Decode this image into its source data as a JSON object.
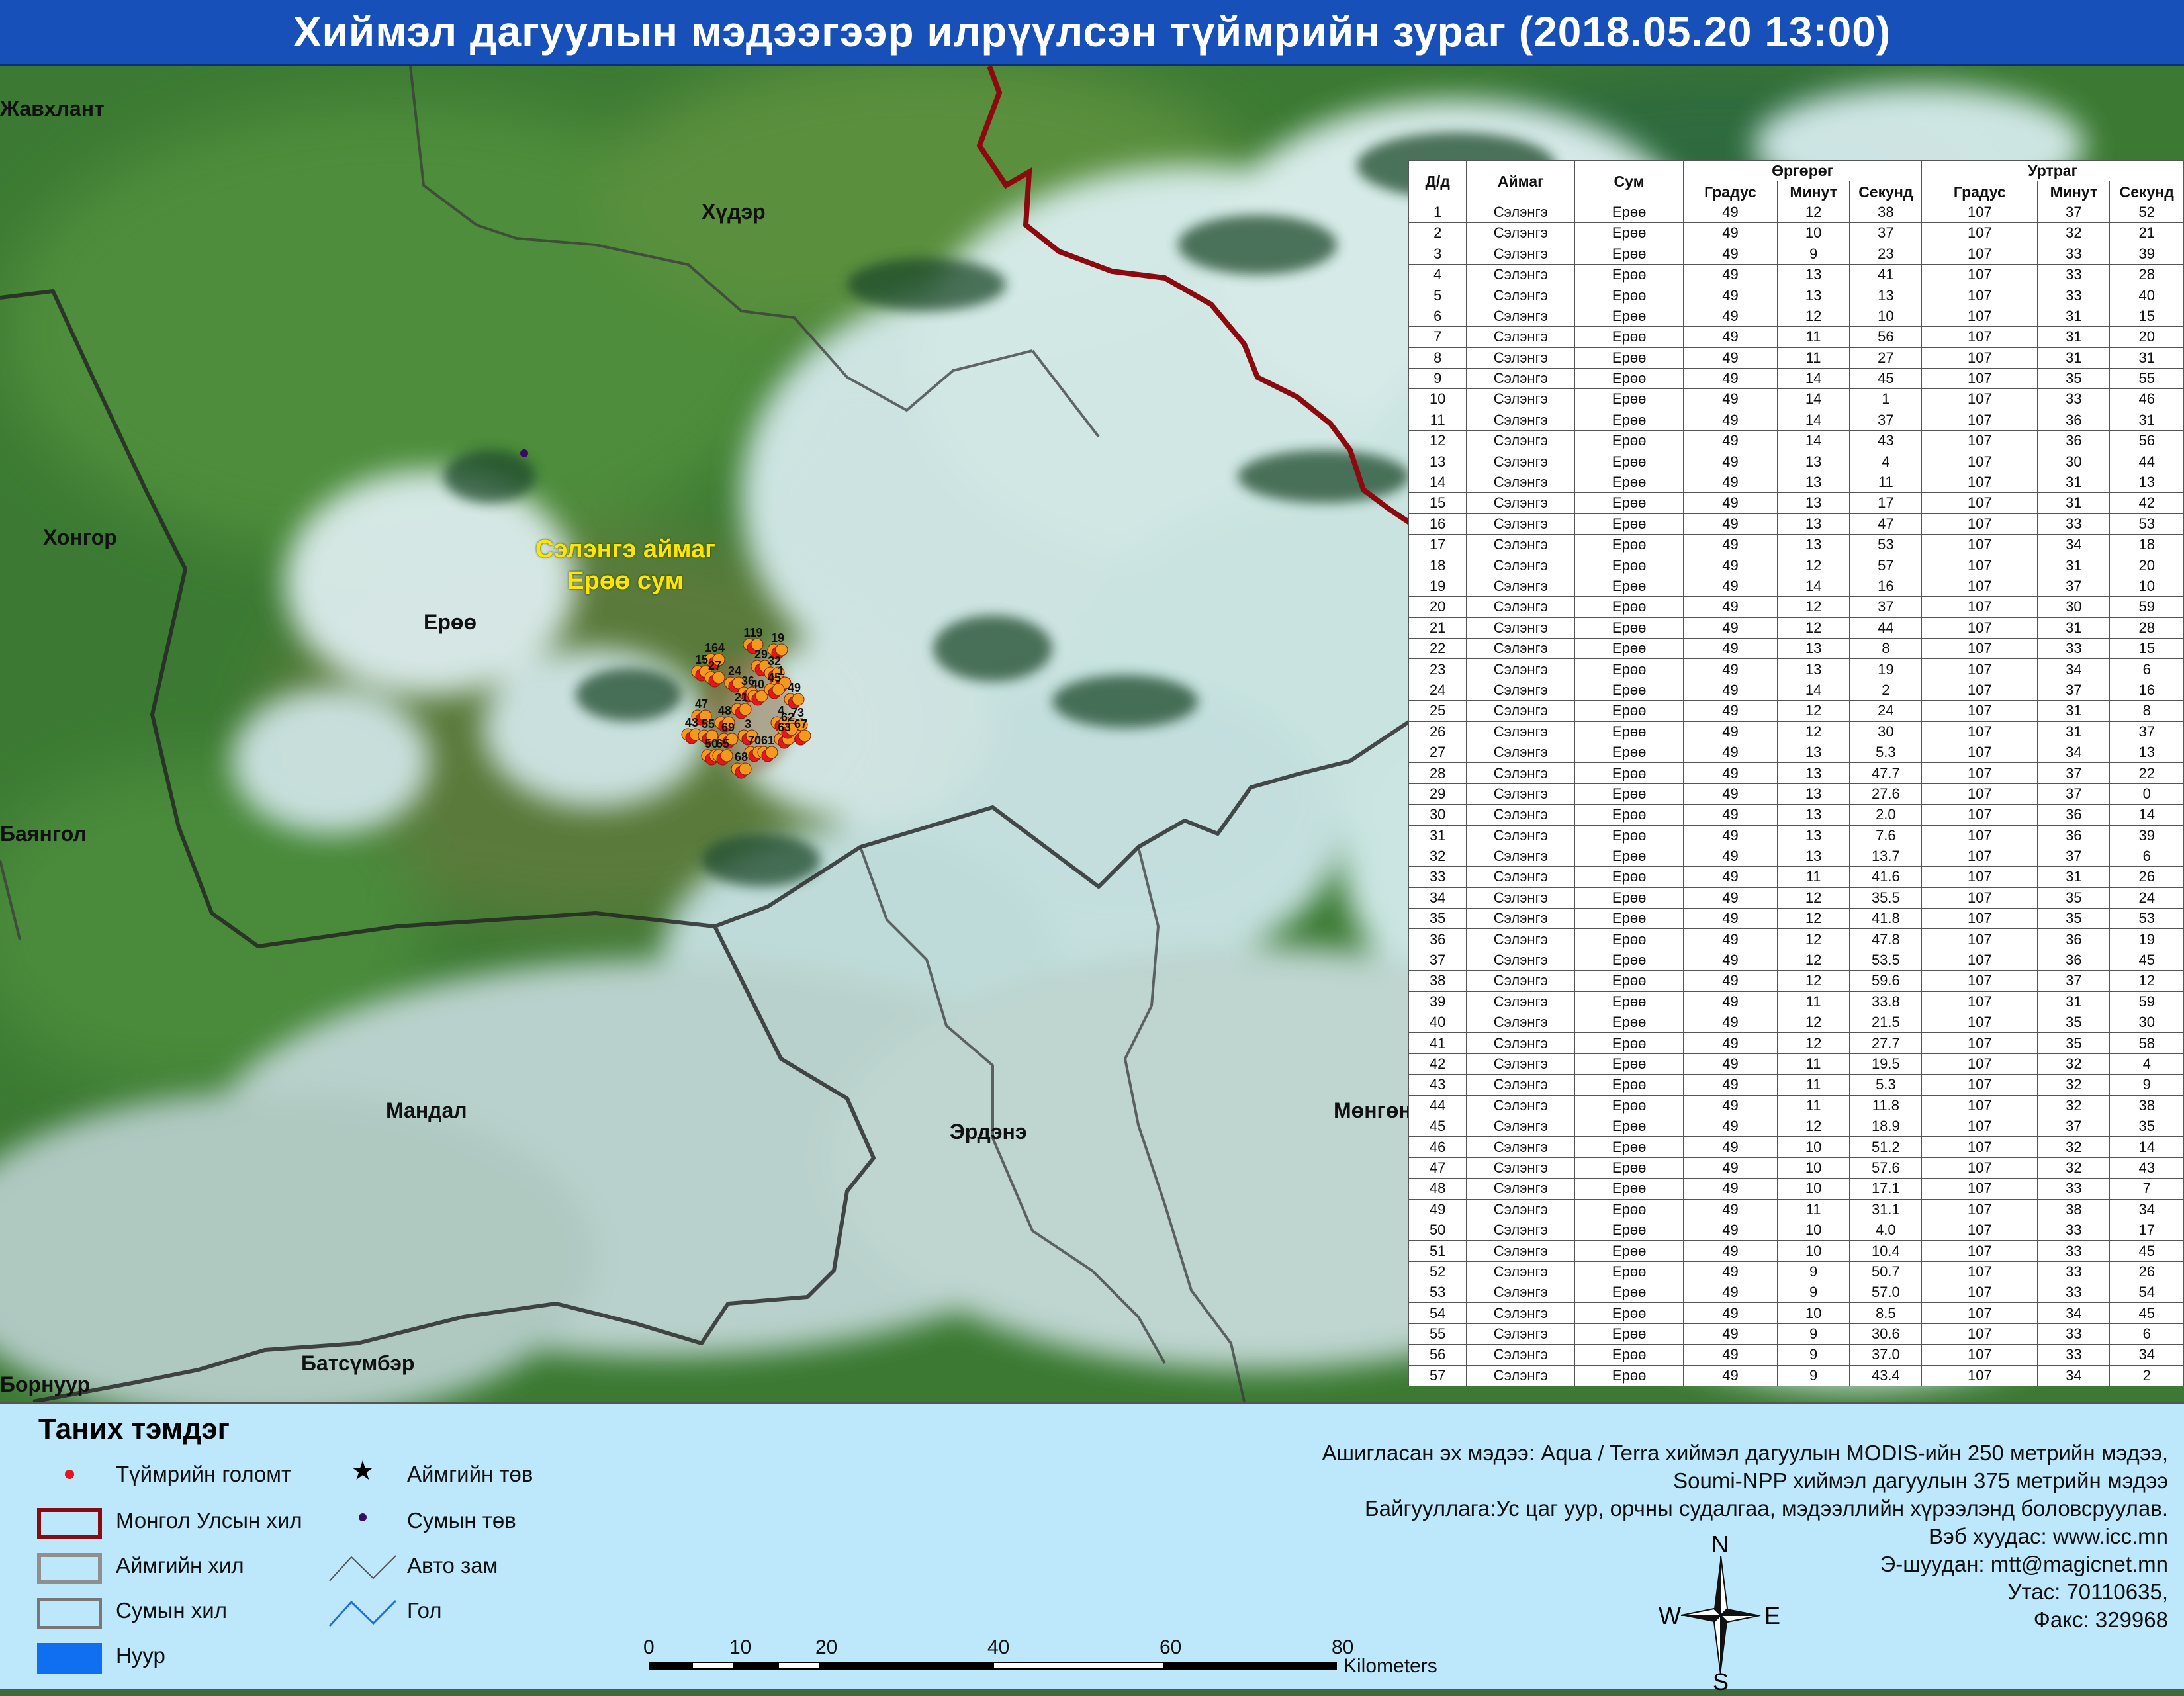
{
  "title": "Хиймэл дагуулын мэдээгээр илрүүлсэн түймрийн зураг  (2018.05.20 13:00)",
  "map": {
    "places": [
      {
        "id": "javkhlant",
        "name": "Жавхлант"
      },
      {
        "id": "khuder",
        "name": "Хүдэр"
      },
      {
        "id": "khongor",
        "name": "Хонгор"
      },
      {
        "id": "yeroo",
        "name": "Ерөө"
      },
      {
        "id": "bayangol",
        "name": "Баянгол"
      },
      {
        "id": "mandal",
        "name": "Мандал"
      },
      {
        "id": "erdene",
        "name": "Эрдэнэ"
      },
      {
        "id": "mungunmorit",
        "name": "Мөнгөн"
      },
      {
        "id": "batsumber",
        "name": "Батсүмбэр"
      },
      {
        "id": "bornuur",
        "name": "Борнуур"
      }
    ],
    "aimag_label_line1": "Сэлэнгэ аймаг",
    "aimag_label_line2": "Ерөө сум",
    "fire_numbers": [
      "119",
      "19",
      "164",
      "29",
      "32",
      "15",
      "27",
      "24",
      "1",
      "36",
      "40",
      "45",
      "49",
      "48",
      "43",
      "55",
      "69",
      "3",
      "4",
      "73",
      "67",
      "50",
      "65",
      "70",
      "61",
      "68",
      "63",
      "62",
      "47",
      "21"
    ]
  },
  "table": {
    "headers": {
      "no": "Д/д",
      "aimag": "Аймаг",
      "sum": "Сум",
      "lat": "Өргөрөг",
      "lon": "Уртраг",
      "deg": "Градус",
      "min": "Минут",
      "sec": "Секунд"
    },
    "rows": [
      [
        "1",
        "Сэлэнгэ",
        "Ерөө",
        "49",
        "12",
        "38",
        "107",
        "37",
        "52"
      ],
      [
        "2",
        "Сэлэнгэ",
        "Ерөө",
        "49",
        "10",
        "37",
        "107",
        "32",
        "21"
      ],
      [
        "3",
        "Сэлэнгэ",
        "Ерөө",
        "49",
        "9",
        "23",
        "107",
        "33",
        "39"
      ],
      [
        "4",
        "Сэлэнгэ",
        "Ерөө",
        "49",
        "13",
        "41",
        "107",
        "33",
        "28"
      ],
      [
        "5",
        "Сэлэнгэ",
        "Ерөө",
        "49",
        "13",
        "13",
        "107",
        "33",
        "40"
      ],
      [
        "6",
        "Сэлэнгэ",
        "Ерөө",
        "49",
        "12",
        "10",
        "107",
        "31",
        "15"
      ],
      [
        "7",
        "Сэлэнгэ",
        "Ерөө",
        "49",
        "11",
        "56",
        "107",
        "31",
        "20"
      ],
      [
        "8",
        "Сэлэнгэ",
        "Ерөө",
        "49",
        "11",
        "27",
        "107",
        "31",
        "31"
      ],
      [
        "9",
        "Сэлэнгэ",
        "Ерөө",
        "49",
        "14",
        "45",
        "107",
        "35",
        "55"
      ],
      [
        "10",
        "Сэлэнгэ",
        "Ерөө",
        "49",
        "14",
        "1",
        "107",
        "33",
        "46"
      ],
      [
        "11",
        "Сэлэнгэ",
        "Ерөө",
        "49",
        "14",
        "37",
        "107",
        "36",
        "31"
      ],
      [
        "12",
        "Сэлэнгэ",
        "Ерөө",
        "49",
        "14",
        "43",
        "107",
        "36",
        "56"
      ],
      [
        "13",
        "Сэлэнгэ",
        "Ерөө",
        "49",
        "13",
        "4",
        "107",
        "30",
        "44"
      ],
      [
        "14",
        "Сэлэнгэ",
        "Ерөө",
        "49",
        "13",
        "11",
        "107",
        "31",
        "13"
      ],
      [
        "15",
        "Сэлэнгэ",
        "Ерөө",
        "49",
        "13",
        "17",
        "107",
        "31",
        "42"
      ],
      [
        "16",
        "Сэлэнгэ",
        "Ерөө",
        "49",
        "13",
        "47",
        "107",
        "33",
        "53"
      ],
      [
        "17",
        "Сэлэнгэ",
        "Ерөө",
        "49",
        "13",
        "53",
        "107",
        "34",
        "18"
      ],
      [
        "18",
        "Сэлэнгэ",
        "Ерөө",
        "49",
        "12",
        "57",
        "107",
        "31",
        "20"
      ],
      [
        "19",
        "Сэлэнгэ",
        "Ерөө",
        "49",
        "14",
        "16",
        "107",
        "37",
        "10"
      ],
      [
        "20",
        "Сэлэнгэ",
        "Ерөө",
        "49",
        "12",
        "37",
        "107",
        "30",
        "59"
      ],
      [
        "21",
        "Сэлэнгэ",
        "Ерөө",
        "49",
        "12",
        "44",
        "107",
        "31",
        "28"
      ],
      [
        "22",
        "Сэлэнгэ",
        "Ерөө",
        "49",
        "13",
        "8",
        "107",
        "33",
        "15"
      ],
      [
        "23",
        "Сэлэнгэ",
        "Ерөө",
        "49",
        "13",
        "19",
        "107",
        "34",
        "6"
      ],
      [
        "24",
        "Сэлэнгэ",
        "Ерөө",
        "49",
        "14",
        "2",
        "107",
        "37",
        "16"
      ],
      [
        "25",
        "Сэлэнгэ",
        "Ерөө",
        "49",
        "12",
        "24",
        "107",
        "31",
        "8"
      ],
      [
        "26",
        "Сэлэнгэ",
        "Ерөө",
        "49",
        "12",
        "30",
        "107",
        "31",
        "37"
      ],
      [
        "27",
        "Сэлэнгэ",
        "Ерөө",
        "49",
        "13",
        "5.3",
        "107",
        "34",
        "13"
      ],
      [
        "28",
        "Сэлэнгэ",
        "Ерөө",
        "49",
        "13",
        "47.7",
        "107",
        "37",
        "22"
      ],
      [
        "29",
        "Сэлэнгэ",
        "Ерөө",
        "49",
        "13",
        "27.6",
        "107",
        "37",
        "0"
      ],
      [
        "30",
        "Сэлэнгэ",
        "Ерөө",
        "49",
        "13",
        "2.0",
        "107",
        "36",
        "14"
      ],
      [
        "31",
        "Сэлэнгэ",
        "Ерөө",
        "49",
        "13",
        "7.6",
        "107",
        "36",
        "39"
      ],
      [
        "32",
        "Сэлэнгэ",
        "Ерөө",
        "49",
        "13",
        "13.7",
        "107",
        "37",
        "6"
      ],
      [
        "33",
        "Сэлэнгэ",
        "Ерөө",
        "49",
        "11",
        "41.6",
        "107",
        "31",
        "26"
      ],
      [
        "34",
        "Сэлэнгэ",
        "Ерөө",
        "49",
        "12",
        "35.5",
        "107",
        "35",
        "24"
      ],
      [
        "35",
        "Сэлэнгэ",
        "Ерөө",
        "49",
        "12",
        "41.8",
        "107",
        "35",
        "53"
      ],
      [
        "36",
        "Сэлэнгэ",
        "Ерөө",
        "49",
        "12",
        "47.8",
        "107",
        "36",
        "19"
      ],
      [
        "37",
        "Сэлэнгэ",
        "Ерөө",
        "49",
        "12",
        "53.5",
        "107",
        "36",
        "45"
      ],
      [
        "38",
        "Сэлэнгэ",
        "Ерөө",
        "49",
        "12",
        "59.6",
        "107",
        "37",
        "12"
      ],
      [
        "39",
        "Сэлэнгэ",
        "Ерөө",
        "49",
        "11",
        "33.8",
        "107",
        "31",
        "59"
      ],
      [
        "40",
        "Сэлэнгэ",
        "Ерөө",
        "49",
        "12",
        "21.5",
        "107",
        "35",
        "30"
      ],
      [
        "41",
        "Сэлэнгэ",
        "Ерөө",
        "49",
        "12",
        "27.7",
        "107",
        "35",
        "58"
      ],
      [
        "42",
        "Сэлэнгэ",
        "Ерөө",
        "49",
        "11",
        "19.5",
        "107",
        "32",
        "4"
      ],
      [
        "43",
        "Сэлэнгэ",
        "Ерөө",
        "49",
        "11",
        "5.3",
        "107",
        "32",
        "9"
      ],
      [
        "44",
        "Сэлэнгэ",
        "Ерөө",
        "49",
        "11",
        "11.8",
        "107",
        "32",
        "38"
      ],
      [
        "45",
        "Сэлэнгэ",
        "Ерөө",
        "49",
        "12",
        "18.9",
        "107",
        "37",
        "35"
      ],
      [
        "46",
        "Сэлэнгэ",
        "Ерөө",
        "49",
        "10",
        "51.2",
        "107",
        "32",
        "14"
      ],
      [
        "47",
        "Сэлэнгэ",
        "Ерөө",
        "49",
        "10",
        "57.6",
        "107",
        "32",
        "43"
      ],
      [
        "48",
        "Сэлэнгэ",
        "Ерөө",
        "49",
        "10",
        "17.1",
        "107",
        "33",
        "7"
      ],
      [
        "49",
        "Сэлэнгэ",
        "Ерөө",
        "49",
        "11",
        "31.1",
        "107",
        "38",
        "34"
      ],
      [
        "50",
        "Сэлэнгэ",
        "Ерөө",
        "49",
        "10",
        "4.0",
        "107",
        "33",
        "17"
      ],
      [
        "51",
        "Сэлэнгэ",
        "Ерөө",
        "49",
        "10",
        "10.4",
        "107",
        "33",
        "45"
      ],
      [
        "52",
        "Сэлэнгэ",
        "Ерөө",
        "49",
        "9",
        "50.7",
        "107",
        "33",
        "26"
      ],
      [
        "53",
        "Сэлэнгэ",
        "Ерөө",
        "49",
        "9",
        "57.0",
        "107",
        "33",
        "54"
      ],
      [
        "54",
        "Сэлэнгэ",
        "Ерөө",
        "49",
        "10",
        "8.5",
        "107",
        "34",
        "45"
      ],
      [
        "55",
        "Сэлэнгэ",
        "Ерөө",
        "49",
        "9",
        "30.6",
        "107",
        "33",
        "6"
      ],
      [
        "56",
        "Сэлэнгэ",
        "Ерөө",
        "49",
        "9",
        "37.0",
        "107",
        "33",
        "34"
      ],
      [
        "57",
        "Сэлэнгэ",
        "Ерөө",
        "49",
        "9",
        "43.4",
        "107",
        "34",
        "2"
      ]
    ]
  },
  "legend": {
    "title": "Таних тэмдэг",
    "fire": "Түймрийн голомт",
    "border": "Монгол Улсын хил",
    "aimag_border": "Аймгийн хил",
    "sum_border": "Сумын хил",
    "lake": "Нуур",
    "aimag_center": "Аймгийн төв",
    "sum_center": "Сумын төв",
    "road": "Авто зам",
    "river": "Гол",
    "colors": {
      "fire": "#e8141e",
      "border": "#8b0a10",
      "lake": "#0f6ff0",
      "sum_center": "#3a0a63",
      "river": "#1f6fe0"
    }
  },
  "source": {
    "line1": "Ашигласан эх мэдээ: Aqua / Terra хиймэл дагуулын MODIS-ийн 250 метрийн мэдээ,",
    "line2": "Soumi-NPP хиймэл дагуулын 375 метрийн мэдээ",
    "line3": "Байгууллага:Ус цаг уур, орчны судалгаа, мэдээллийн хүрээлэнд боловсруулав.",
    "line4": "Вэб хуудас: www.icc.mn",
    "line5": "Э-шуудан: mtt@magicnet.mn",
    "line6": "Утас: 70110635,",
    "line7": "Факс: 329968"
  },
  "compass": {
    "n": "N",
    "s": "S",
    "e": "E",
    "w": "W"
  },
  "scale": {
    "ticks": [
      "0",
      "10",
      "20",
      "40",
      "60",
      "80"
    ],
    "unit": "Kilometers"
  }
}
